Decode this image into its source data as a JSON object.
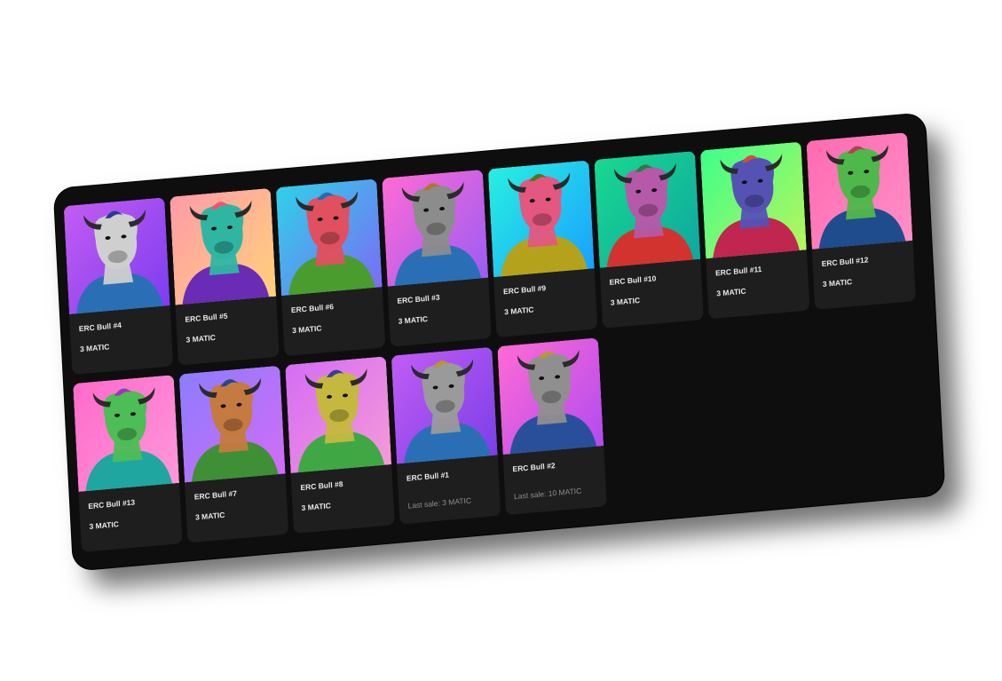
{
  "gallery": {
    "rows": [
      [
        {
          "name": "ERC Bull #4",
          "price": "3 MATIC",
          "bg": [
            "#c35cf2",
            "#7c3df0"
          ],
          "skin": "#cfcfcf",
          "shirt": "#2a6fb5",
          "hair": "#2b3a8f"
        },
        {
          "name": "ERC Bull #5",
          "price": "3 MATIC",
          "bg": [
            "#ff9aa8",
            "#ffd27a"
          ],
          "skin": "#2fb6a2",
          "shirt": "#6a2bb5",
          "hair": "#ff4d6d"
        },
        {
          "name": "ERC Bull #6",
          "price": "3 MATIC",
          "bg": [
            "#2fd1e8",
            "#7b6cf5"
          ],
          "skin": "#e0505f",
          "shirt": "#4a9c2e",
          "hair": "#1d6fb8"
        },
        {
          "name": "ERC Bull #3",
          "price": "3 MATIC",
          "bg": [
            "#ff6ad5",
            "#9a5cf5"
          ],
          "skin": "#8c8c8c",
          "shirt": "#2a6fb5",
          "hair": "#b0752e"
        },
        {
          "name": "ERC Bull #9",
          "price": "3 MATIC",
          "bg": [
            "#28f0e0",
            "#1aa0ff"
          ],
          "skin": "#e4577f",
          "shirt": "#b5a21c",
          "hair": "#4a7a1a"
        },
        {
          "name": "ERC Bull #10",
          "price": "3 MATIC",
          "bg": [
            "#18d98f",
            "#0fa7a0"
          ],
          "skin": "#b45aa8",
          "shirt": "#d3332f",
          "hair": "#2e7a3f"
        },
        {
          "name": "ERC Bull #11",
          "price": "3 MATIC",
          "bg": [
            "#3cff8a",
            "#b8f55c"
          ],
          "skin": "#5552b4",
          "shirt": "#c0264f",
          "hair": "#d14e3f"
        },
        {
          "name": "ERC Bull #12",
          "price": "3 MATIC",
          "bg": [
            "#ff6ab0",
            "#ff8fc8"
          ],
          "skin": "#4fb84a",
          "shirt": "#1e4c8c",
          "hair": "#b43f55"
        }
      ],
      [
        {
          "name": "ERC Bull #13",
          "price": "3 MATIC",
          "bg": [
            "#ff6acb",
            "#ff98d9"
          ],
          "skin": "#4dbd55",
          "shirt": "#20a6a0",
          "hair": "#9a3ab3"
        },
        {
          "name": "ERC Bull #7",
          "price": "3 MATIC",
          "bg": [
            "#8d7cff",
            "#d26cf5"
          ],
          "skin": "#c57a3f",
          "shirt": "#3e8f35",
          "hair": "#1f4b8a"
        },
        {
          "name": "ERC Bull #8",
          "price": "3 MATIC",
          "bg": [
            "#d56cf5",
            "#f59ad8"
          ],
          "skin": "#c6b83f",
          "shirt": "#3fa845",
          "hair": "#3b3d9a"
        },
        {
          "name": "ERC Bull #1",
          "sale": "Last sale: 3 MATIC",
          "bg": [
            "#c15cf5",
            "#7a3fe8"
          ],
          "skin": "#9a9a9a",
          "shirt": "#2a6fb5",
          "hair": "#b49a2e"
        },
        {
          "name": "ERC Bull #2",
          "sale": "Last sale: 10 MATIC",
          "bg": [
            "#ff6ad5",
            "#b14bf0"
          ],
          "skin": "#8f8f8f",
          "shirt": "#2a4f9a",
          "hair": "#b49a2e"
        }
      ]
    ]
  }
}
